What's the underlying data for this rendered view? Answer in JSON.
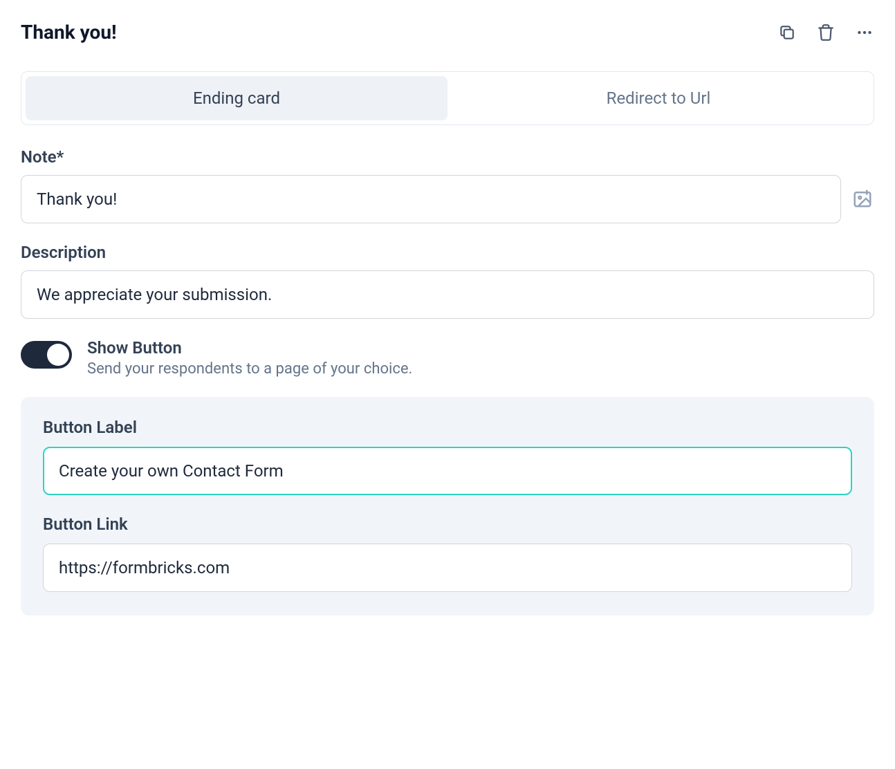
{
  "header": {
    "title": "Thank you!"
  },
  "tabs": {
    "ending_card": "Ending card",
    "redirect": "Redirect to Url"
  },
  "fields": {
    "note": {
      "label": "Note*",
      "value": "Thank you!"
    },
    "description": {
      "label": "Description",
      "value": "We appreciate your submission."
    }
  },
  "show_button": {
    "title": "Show Button",
    "subtitle": "Send your respondents to a page of your choice."
  },
  "button_panel": {
    "label": {
      "label": "Button Label",
      "value": "Create your own Contact Form"
    },
    "link": {
      "label": "Button Link",
      "value": "https://formbricks.com"
    }
  }
}
